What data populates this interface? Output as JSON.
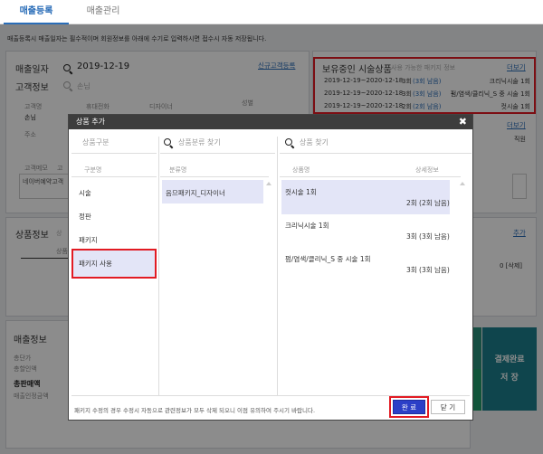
{
  "tabs": [
    {
      "label": "매출등록",
      "active": true
    },
    {
      "label": "매출관리",
      "active": false
    }
  ],
  "notice": "매출등록시 매출일자는 필수적이며 회원정보를 아래에 수기로 입력하시면 접수시 자동 저장됩니다.",
  "main": {
    "date_label": "매출일자",
    "date_value": "2019-12-19",
    "new_customer_link": "신규고객등록",
    "customer_label": "고객정보",
    "customer_placeholder": "손님",
    "col_name": "고객명",
    "col_phone": "휴대전화",
    "col_designer": "디자이너",
    "col_gender": "성별",
    "name_value": "손님",
    "address_label": "주소",
    "memo_label": "고객메모",
    "memo_value": "네이버예약고객",
    "memo_hint": "고"
  },
  "owned": {
    "title": "보유중인 시술상품",
    "subtitle": "사용 가능한 패키지 정보",
    "more_link": "더보기",
    "rows": [
      {
        "period": "2019-12-19~2020-12-18",
        "count": "3회",
        "remain": "(3회 남음)",
        "name": "크리닉시술 1회"
      },
      {
        "period": "2019-12-19~2020-12-18",
        "count": "3회",
        "remain": "(3회 남음)",
        "name": "펌/염색/클리닉_S 중 시술 1회"
      },
      {
        "period": "2019-12-19~2020-12-18",
        "count": "2회",
        "remain": "(2회 남음)",
        "name": "컷시술 1회"
      }
    ],
    "more_link2": "더보기",
    "job_value": "직원"
  },
  "product": {
    "title": "상품정보",
    "hint": "상",
    "col": "상품",
    "add_link": "추가",
    "right_value": "0 [삭제]"
  },
  "sales": {
    "title": "매출정보",
    "total_label": "총단가",
    "discount_label": "총할인액",
    "sales_amount_label": "총판매액",
    "recognized_label": "매출인정금액"
  },
  "side_buttons": {
    "pay_complete": "결제완료",
    "save": "저 장"
  },
  "modal": {
    "title": "상품 추가",
    "close": "✖",
    "col1_header": "상품구분",
    "col1_sub": "구분명",
    "col1_items": [
      "시술",
      "정판",
      "패키지",
      "패키지 사용"
    ],
    "col2_search": "상품분류 찾기",
    "col2_sub": "분류명",
    "col2_items": [
      "음므패키지_디자이너"
    ],
    "col3_search": "상품 찾기",
    "col3_sub_name": "상품명",
    "col3_sub_detail": "상세정보",
    "col3_items": [
      {
        "name": "컷시술 1회",
        "detail": "2회 (2회 남음)"
      },
      {
        "name": "크리닉시술 1회",
        "detail": "3회 (3회 남음)"
      },
      {
        "name": "펌/염색/클리닉_S 중 시술 1회",
        "detail": "3회 (3회 남음)"
      }
    ],
    "footer_note": "패키지 수정의 경우 수정시 자동으로 관련정보가 모두 삭제 되오니 이점 유의하여 주시기 바랍니다.",
    "ok_button": "완 료",
    "close_button": "닫 기"
  },
  "colors": {
    "accent": "#2a6db8",
    "highlight": "#e21b23",
    "primary_button": "#2b3fc7",
    "teal": "#1d7f8c"
  }
}
